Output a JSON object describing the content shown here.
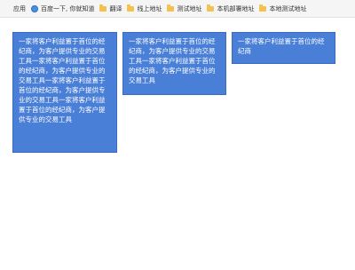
{
  "bookmarks": {
    "apps_label": "应用",
    "items": [
      {
        "label": "百度一下, 你就知道",
        "icon": "globe-icon"
      },
      {
        "label": "翻译",
        "icon": "folder-icon"
      },
      {
        "label": "线上地址",
        "icon": "folder-icon"
      },
      {
        "label": "测试地址",
        "icon": "folder-icon"
      },
      {
        "label": "本机部署地址",
        "icon": "folder-icon"
      },
      {
        "label": "本地测试地址",
        "icon": "folder-icon"
      }
    ]
  },
  "cards": [
    {
      "text": "一家将客户利益置于首位的经纪商，为客户提供专业的交易工具一家将客户利益置于首位的经纪商，为客户提供专业的交易工具一家将客户利益置于首位的经纪商，为客户提供专业的交易工具一家将客户利益置于首位的经纪商，为客户提供专业的交易工具"
    },
    {
      "text": "一家将客户利益置于首位的经纪商，为客户提供专业的交易工具一家将客户利益置于首位的经纪商，为客户提供专业的交易工具"
    },
    {
      "text": "一家将客户利益置于首位的经纪商"
    }
  ]
}
